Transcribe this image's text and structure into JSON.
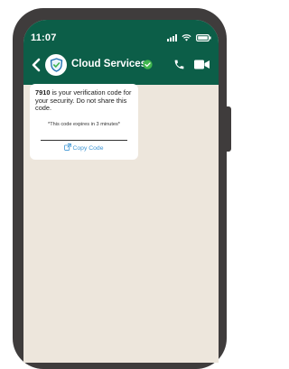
{
  "status_bar": {
    "time": "11:07"
  },
  "header": {
    "contact_name": "Cloud Services",
    "verified": true
  },
  "message": {
    "code": "7910",
    "body": " is your verification code for your security. Do not share this code.",
    "expiry_note": "*This code expires in 3 minutes*",
    "copy_label": "Copy Code"
  },
  "colors": {
    "header": "#0c5e48",
    "chat_background": "#ede6dc",
    "link": "#3d95d4",
    "verified_badge": "#3fb54e",
    "phone_frame": "#3f3c3c"
  },
  "icons": [
    "back-arrow-icon",
    "shield-check-icon",
    "verified-badge-icon",
    "phone-call-icon",
    "video-camera-icon",
    "copy-icon",
    "signal-icon",
    "wifi-icon",
    "battery-icon"
  ]
}
